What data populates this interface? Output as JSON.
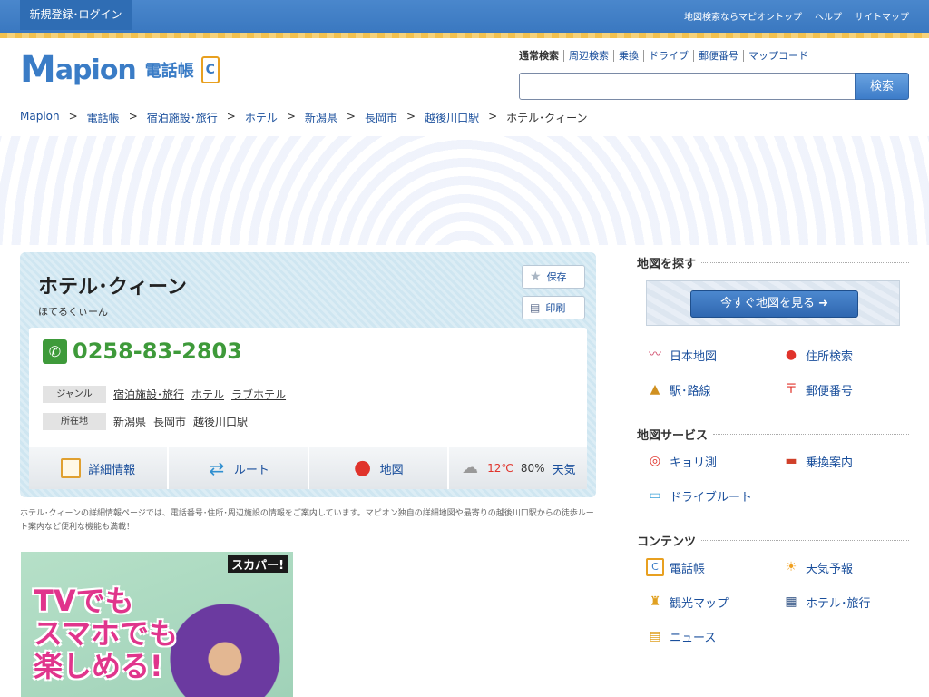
{
  "topbar": {
    "login": "新規登録･ログイン",
    "links": [
      "地図検索ならマピオントップ",
      "ヘルプ",
      "サイトマップ"
    ]
  },
  "header": {
    "logo_m": "M",
    "logo_rest": "apion",
    "logo_sub": "電話帳",
    "search_tabs": [
      "通常検索",
      "周辺検索",
      "乗換",
      "ドライブ",
      "郵便番号",
      "マップコード"
    ],
    "search_placeholder": "",
    "search_button": "検索"
  },
  "breadcrumb": [
    "Mapion",
    "電話帳",
    "宿泊施設･旅行",
    "ホテル",
    "新潟県",
    "長岡市",
    "越後川口駅",
    "ホテル･クィーン"
  ],
  "place": {
    "name": "ホテル･クィーン",
    "kana": "ほてるくぃーん",
    "save": "保存",
    "print": "印刷",
    "phone": "0258-83-2803",
    "genre_label": "ジャンル",
    "genres": [
      "宿泊施設･旅行",
      "ホテル",
      "ラブホテル"
    ],
    "location_label": "所在地",
    "locations": [
      "新潟県",
      "長岡市",
      "越後川口駅"
    ],
    "actions": {
      "detail": "詳細情報",
      "route": "ルート",
      "map": "地図",
      "temp": "12℃",
      "humidity": "80%",
      "weather": "天気"
    }
  },
  "description": "ホテル･クィーンの詳細情報ページでは、電話番号･住所･周辺施設の情報をご案内しています。マピオン独自の詳細地図や最寄りの越後川口駅からの徒歩ルート案内など便利な機能も満載！",
  "ad": {
    "brand": "スカパー!",
    "line1": "TVでも",
    "line2": "スマホでも",
    "line3": "楽しめる!"
  },
  "sidebar": {
    "find_map_title": "地図を探す",
    "map_button": "今すぐ地図を見る",
    "find_items": [
      "日本地図",
      "住所検索",
      "駅･路線",
      "郵便番号"
    ],
    "service_title": "地図サービス",
    "service_items": [
      "キョリ測",
      "乗換案内",
      "ドライブルート"
    ],
    "contents_title": "コンテンツ",
    "contents_items": [
      "電話帳",
      "天気予報",
      "観光マップ",
      "ホテル･旅行",
      "ニュース"
    ]
  },
  "colors": {
    "brand_blue": "#3a7cc6",
    "phone_green": "#3e9a3a",
    "temp_red": "#e0332b",
    "link": "#1a4f9c"
  }
}
